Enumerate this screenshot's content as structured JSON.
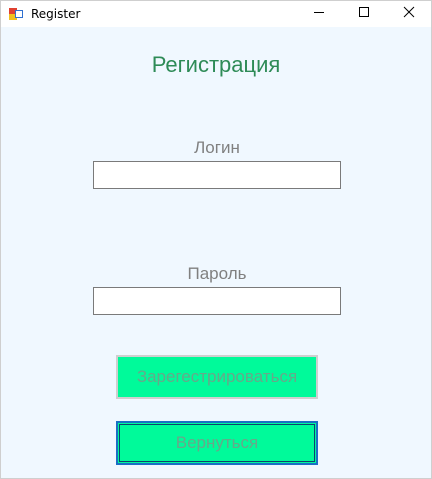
{
  "window": {
    "title": "Register",
    "controls": {
      "minimize": "minimize-icon",
      "maximize": "maximize-icon",
      "close": "close-icon"
    }
  },
  "form": {
    "heading": "Регистрация",
    "login_label": "Логин",
    "login_value": "",
    "password_label": "Пароль",
    "password_value": "",
    "register_button": "Зарегестрироваться",
    "back_button": "Вернуться"
  },
  "colors": {
    "background": "#f0f8ff",
    "heading": "#2e8b57",
    "button": "#00fa9a",
    "label": "#808080"
  }
}
